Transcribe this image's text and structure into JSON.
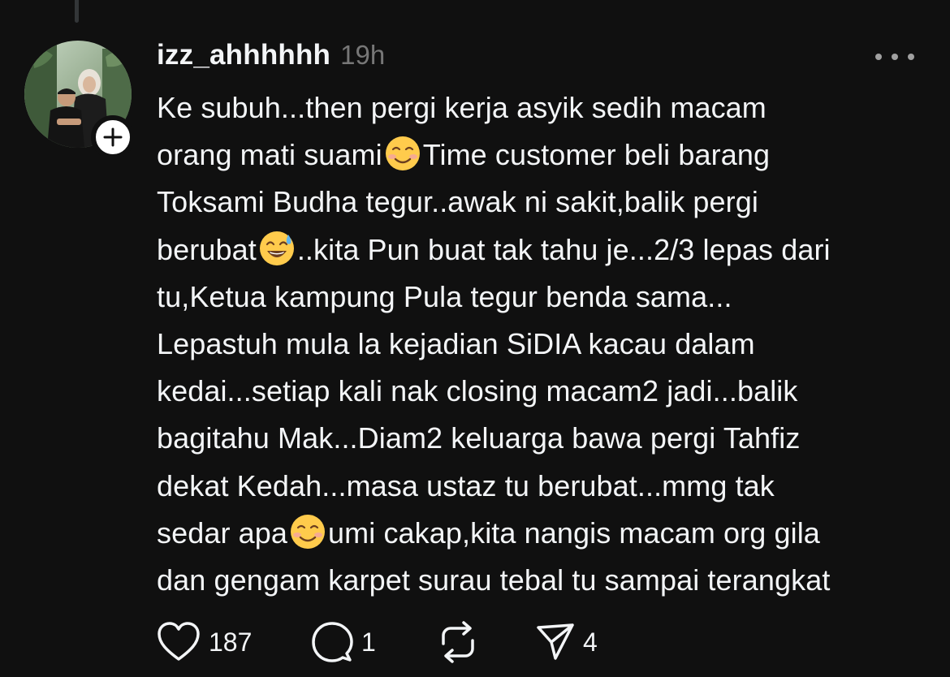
{
  "post": {
    "username": "izz_ahhhhhh",
    "timestamp": "19h",
    "lines": [
      {
        "before": "Ke subuh...then pergi kerja asyik sedih macam",
        "emoji": "",
        "after": ""
      },
      {
        "before": "orang mati suami",
        "emoji": "smiling-face-icon",
        "after": "Time customer beli barang"
      },
      {
        "before": "Toksami Budha tegur..awak ni sakit,balik pergi",
        "emoji": "",
        "after": ""
      },
      {
        "before": "berubat",
        "emoji": "sweat-smile-icon",
        "after": "..kita Pun buat tak tahu je...2/3 lepas dari"
      },
      {
        "before": "tu,Ketua kampung Pula tegur benda sama...",
        "emoji": "",
        "after": ""
      },
      {
        "before": "Lepastuh mula la kejadian SiDIA kacau dalam",
        "emoji": "",
        "after": ""
      },
      {
        "before": "kedai...setiap kali nak closing macam2 jadi...balik",
        "emoji": "",
        "after": ""
      },
      {
        "before": "bagitahu Mak...Diam2 keluarga bawa pergi Tahfiz",
        "emoji": "",
        "after": ""
      },
      {
        "before": "dekat Kedah...masa ustaz tu berubat...mmg tak",
        "emoji": "",
        "after": ""
      },
      {
        "before": "sedar apa",
        "emoji": "smiling-face-icon",
        "after": "umi cakap,kita nangis macam org gila"
      },
      {
        "before": "dan gengam karpet surau tebal tu sampai terangkat",
        "emoji": "",
        "after": ""
      }
    ]
  },
  "actions": {
    "likes": "187",
    "replies": "1",
    "shares": "4"
  },
  "icons": {
    "like": "heart-icon",
    "reply": "comment-icon",
    "repost": "repost-icon",
    "share": "send-icon",
    "more": "more-icon",
    "follow": "plus-icon"
  },
  "colors": {
    "background": "#101010",
    "text": "#f3f5f7",
    "muted": "#777777",
    "emoji_yellow": "#ffcb4c"
  }
}
